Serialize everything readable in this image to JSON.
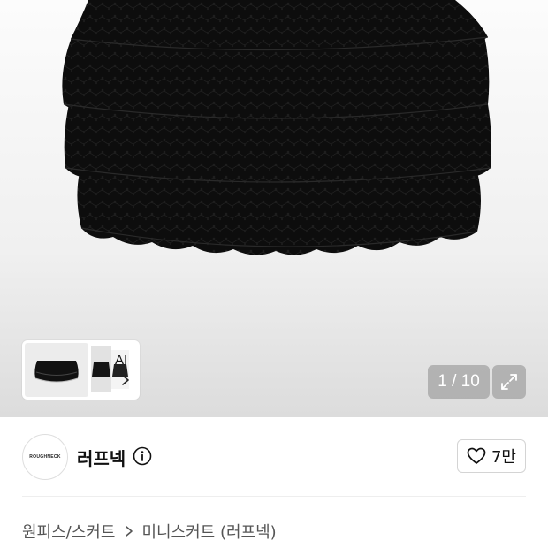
{
  "product_image": {
    "counter": "1 / 10",
    "subject": "black layered lace ruffle mini skirt"
  },
  "thumbnail_strip": {
    "ai_label": "AI"
  },
  "brand": {
    "logo_text": "ROUGHNECK",
    "name": "러프넥",
    "like_count": "7만"
  },
  "breadcrumb": {
    "category": "원피스/스커트",
    "subcategory": "미니스커트 (러프넥)"
  },
  "icons": [
    "chevron-right-icon",
    "expand-icon",
    "info-icon",
    "heart-icon"
  ]
}
